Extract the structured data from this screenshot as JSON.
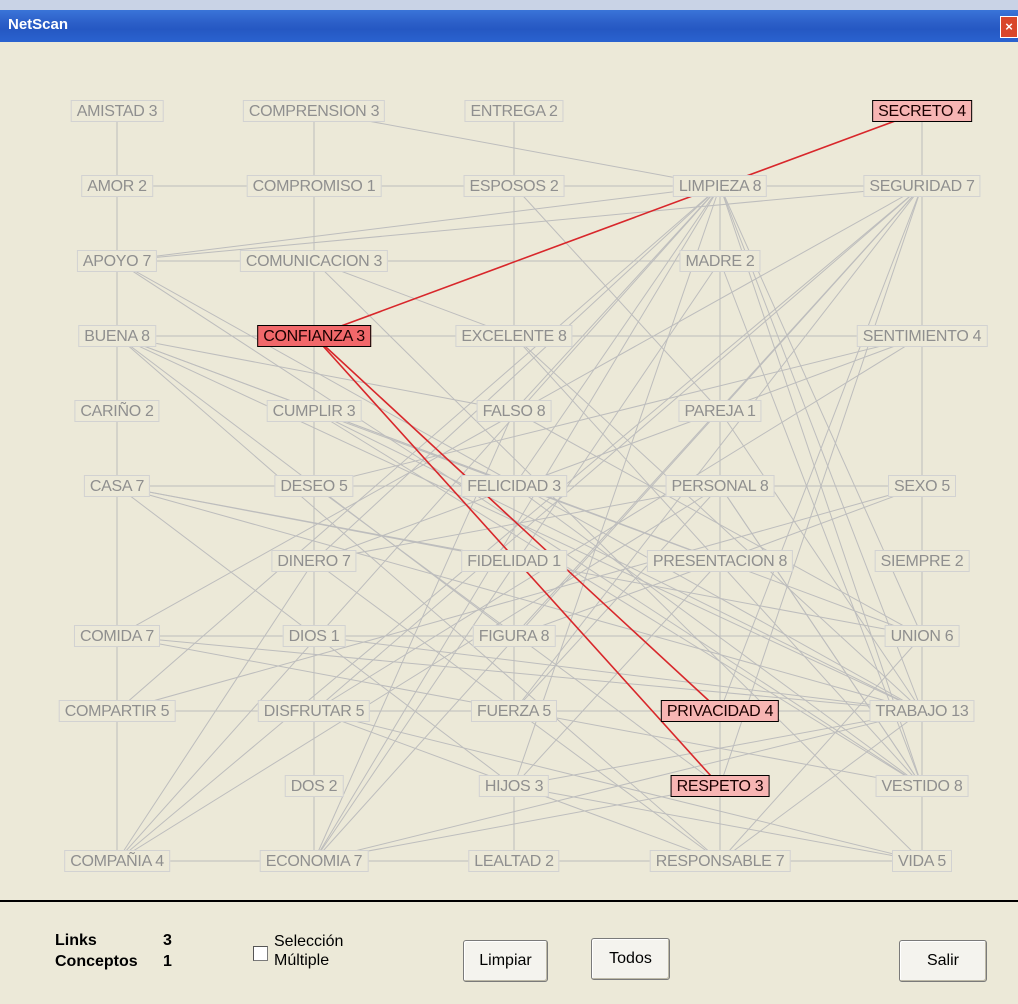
{
  "window": {
    "title": "NetScan",
    "close_label": "×"
  },
  "nodes": [
    {
      "id": "amistad",
      "label": "AMISTAD 3",
      "col": 0,
      "row": 0
    },
    {
      "id": "comprension",
      "label": "COMPRENSION 3",
      "col": 1,
      "row": 0
    },
    {
      "id": "entrega",
      "label": "ENTREGA 2",
      "col": 2,
      "row": 0
    },
    {
      "id": "secreto",
      "label": "SECRETO 4",
      "col": 4,
      "row": 0,
      "state": "linked"
    },
    {
      "id": "amor",
      "label": "AMOR 2",
      "col": 0,
      "row": 1
    },
    {
      "id": "compromiso",
      "label": "COMPROMISO 1",
      "col": 1,
      "row": 1
    },
    {
      "id": "esposos",
      "label": "ESPOSOS 2",
      "col": 2,
      "row": 1
    },
    {
      "id": "limpieza",
      "label": "LIMPIEZA 8",
      "col": 3,
      "row": 1
    },
    {
      "id": "seguridad",
      "label": "SEGURIDAD 7",
      "col": 4,
      "row": 1
    },
    {
      "id": "apoyo",
      "label": "APOYO 7",
      "col": 0,
      "row": 2
    },
    {
      "id": "comunicacion",
      "label": "COMUNICACION 3",
      "col": 1,
      "row": 2
    },
    {
      "id": "madre",
      "label": "MADRE 2",
      "col": 3,
      "row": 2
    },
    {
      "id": "buena",
      "label": "BUENA 8",
      "col": 0,
      "row": 3
    },
    {
      "id": "confianza",
      "label": "CONFIANZA 3",
      "col": 1,
      "row": 3,
      "state": "selected"
    },
    {
      "id": "excelente",
      "label": "EXCELENTE 8",
      "col": 2,
      "row": 3
    },
    {
      "id": "sentimiento",
      "label": "SENTIMIENTO 4",
      "col": 4,
      "row": 3
    },
    {
      "id": "carino",
      "label": "CARIÑO 2",
      "col": 0,
      "row": 4
    },
    {
      "id": "cumplir",
      "label": "CUMPLIR 3",
      "col": 1,
      "row": 4
    },
    {
      "id": "falso",
      "label": "FALSO 8",
      "col": 2,
      "row": 4
    },
    {
      "id": "pareja",
      "label": "PAREJA 1",
      "col": 3,
      "row": 4
    },
    {
      "id": "casa",
      "label": "CASA 7",
      "col": 0,
      "row": 5
    },
    {
      "id": "deseo",
      "label": "DESEO 5",
      "col": 1,
      "row": 5
    },
    {
      "id": "felicidad",
      "label": "FELICIDAD 3",
      "col": 2,
      "row": 5
    },
    {
      "id": "personal",
      "label": "PERSONAL 8",
      "col": 3,
      "row": 5
    },
    {
      "id": "sexo",
      "label": "SEXO 5",
      "col": 4,
      "row": 5
    },
    {
      "id": "dinero",
      "label": "DINERO 7",
      "col": 1,
      "row": 6
    },
    {
      "id": "fidelidad",
      "label": "FIDELIDAD 1",
      "col": 2,
      "row": 6
    },
    {
      "id": "presentacion",
      "label": "PRESENTACION 8",
      "col": 3,
      "row": 6
    },
    {
      "id": "siempre",
      "label": "SIEMPRE 2",
      "col": 4,
      "row": 6
    },
    {
      "id": "comida",
      "label": "COMIDA 7",
      "col": 0,
      "row": 7
    },
    {
      "id": "dios",
      "label": "DIOS 1",
      "col": 1,
      "row": 7
    },
    {
      "id": "figura",
      "label": "FIGURA 8",
      "col": 2,
      "row": 7
    },
    {
      "id": "union",
      "label": "UNION 6",
      "col": 4,
      "row": 7
    },
    {
      "id": "compartir",
      "label": "COMPARTIR 5",
      "col": 0,
      "row": 8
    },
    {
      "id": "disfrutar",
      "label": "DISFRUTAR 5",
      "col": 1,
      "row": 8
    },
    {
      "id": "fuerza",
      "label": "FUERZA 5",
      "col": 2,
      "row": 8
    },
    {
      "id": "privacidad",
      "label": "PRIVACIDAD 4",
      "col": 3,
      "row": 8,
      "state": "linked"
    },
    {
      "id": "trabajo",
      "label": "TRABAJO 13",
      "col": 4,
      "row": 8
    },
    {
      "id": "dos",
      "label": "DOS 2",
      "col": 1,
      "row": 9
    },
    {
      "id": "hijos",
      "label": "HIJOS 3",
      "col": 2,
      "row": 9
    },
    {
      "id": "respeto",
      "label": "RESPETO 3",
      "col": 3,
      "row": 9,
      "state": "linked"
    },
    {
      "id": "vestido",
      "label": "VESTIDO 8",
      "col": 4,
      "row": 9
    },
    {
      "id": "compania",
      "label": "COMPAÑIA 4",
      "col": 0,
      "row": 10
    },
    {
      "id": "economia",
      "label": "ECONOMIA 7",
      "col": 1,
      "row": 10
    },
    {
      "id": "lealtad",
      "label": "LEALTAD 2",
      "col": 2,
      "row": 10
    },
    {
      "id": "responsable",
      "label": "RESPONSABLE 7",
      "col": 3,
      "row": 10
    },
    {
      "id": "vida",
      "label": "VIDA 5",
      "col": 4,
      "row": 10
    }
  ],
  "highlighted_links": [
    [
      "confianza",
      "secreto"
    ],
    [
      "confianza",
      "privacidad"
    ],
    [
      "confianza",
      "respeto"
    ]
  ],
  "links": [
    [
      "amistad",
      "amor"
    ],
    [
      "amor",
      "apoyo"
    ],
    [
      "apoyo",
      "buena"
    ],
    [
      "buena",
      "carino"
    ],
    [
      "carino",
      "casa"
    ],
    [
      "casa",
      "comida"
    ],
    [
      "comida",
      "compartir"
    ],
    [
      "compartir",
      "compania"
    ],
    [
      "comprension",
      "compromiso"
    ],
    [
      "compromiso",
      "comunicacion"
    ],
    [
      "comunicacion",
      "confianza"
    ],
    [
      "confianza",
      "cumplir"
    ],
    [
      "cumplir",
      "deseo"
    ],
    [
      "deseo",
      "dinero"
    ],
    [
      "dinero",
      "dios"
    ],
    [
      "dios",
      "disfrutar"
    ],
    [
      "disfrutar",
      "dos"
    ],
    [
      "dos",
      "economia"
    ],
    [
      "entrega",
      "esposos"
    ],
    [
      "excelente",
      "falso"
    ],
    [
      "falso",
      "felicidad"
    ],
    [
      "felicidad",
      "fidelidad"
    ],
    [
      "fidelidad",
      "figura"
    ],
    [
      "figura",
      "fuerza"
    ],
    [
      "hijos",
      "lealtad"
    ],
    [
      "limpieza",
      "madre"
    ],
    [
      "madre",
      "pareja"
    ],
    [
      "pareja",
      "personal"
    ],
    [
      "personal",
      "presentacion"
    ],
    [
      "secreto",
      "seguridad"
    ],
    [
      "seguridad",
      "sentimiento"
    ],
    [
      "sentimiento",
      "sexo"
    ],
    [
      "sexo",
      "siempre"
    ],
    [
      "siempre",
      "union"
    ],
    [
      "union",
      "trabajo"
    ],
    [
      "trabajo",
      "vestido"
    ],
    [
      "vestido",
      "vida"
    ],
    [
      "amor",
      "compromiso"
    ],
    [
      "compromiso",
      "esposos"
    ],
    [
      "esposos",
      "limpieza"
    ],
    [
      "limpieza",
      "seguridad"
    ],
    [
      "apoyo",
      "comunicacion"
    ],
    [
      "comunicacion",
      "madre"
    ],
    [
      "buena",
      "confianza"
    ],
    [
      "confianza",
      "excelente"
    ],
    [
      "excelente",
      "sentimiento"
    ],
    [
      "casa",
      "deseo"
    ],
    [
      "deseo",
      "felicidad"
    ],
    [
      "felicidad",
      "personal"
    ],
    [
      "personal",
      "sexo"
    ],
    [
      "compartir",
      "disfrutar"
    ],
    [
      "disfrutar",
      "fuerza"
    ],
    [
      "fuerza",
      "privacidad"
    ],
    [
      "privacidad",
      "trabajo"
    ],
    [
      "compania",
      "economia"
    ],
    [
      "economia",
      "lealtad"
    ],
    [
      "lealtad",
      "responsable"
    ],
    [
      "responsable",
      "vida"
    ],
    [
      "amistad",
      "buena"
    ],
    [
      "amistad",
      "casa"
    ],
    [
      "comprension",
      "limpieza"
    ],
    [
      "comprension",
      "cumplir"
    ],
    [
      "entrega",
      "felicidad"
    ],
    [
      "entrega",
      "excelente"
    ],
    [
      "apoyo",
      "seguridad"
    ],
    [
      "apoyo",
      "limpieza"
    ],
    [
      "apoyo",
      "trabajo"
    ],
    [
      "apoyo",
      "vestido"
    ],
    [
      "buena",
      "falso"
    ],
    [
      "buena",
      "trabajo"
    ],
    [
      "buena",
      "union"
    ],
    [
      "buena",
      "responsable"
    ],
    [
      "buena",
      "figura"
    ],
    [
      "buena",
      "presentacion"
    ],
    [
      "casa",
      "trabajo"
    ],
    [
      "casa",
      "hijos"
    ],
    [
      "casa",
      "union"
    ],
    [
      "casa",
      "fidelidad"
    ],
    [
      "comida",
      "trabajo"
    ],
    [
      "comida",
      "seguridad"
    ],
    [
      "comida",
      "figura"
    ],
    [
      "comida",
      "vestido"
    ],
    [
      "compartir",
      "limpieza"
    ],
    [
      "compartir",
      "sexo"
    ],
    [
      "compania",
      "seguridad"
    ],
    [
      "compania",
      "dinero"
    ],
    [
      "compania",
      "personal"
    ],
    [
      "compania",
      "limpieza"
    ],
    [
      "comunicacion",
      "vida"
    ],
    [
      "comunicacion",
      "excelente"
    ],
    [
      "cumplir",
      "trabajo"
    ],
    [
      "cumplir",
      "economia"
    ],
    [
      "cumplir",
      "presentacion"
    ],
    [
      "cumplir",
      "vestido"
    ],
    [
      "deseo",
      "sentimiento"
    ],
    [
      "deseo",
      "respeto"
    ],
    [
      "dinero",
      "limpieza"
    ],
    [
      "dinero",
      "sentimiento"
    ],
    [
      "dinero",
      "economia"
    ],
    [
      "dinero",
      "responsable"
    ],
    [
      "dios",
      "trabajo"
    ],
    [
      "dios",
      "union"
    ],
    [
      "disfrutar",
      "vida"
    ],
    [
      "disfrutar",
      "seguridad"
    ],
    [
      "disfrutar",
      "responsable"
    ],
    [
      "economia",
      "trabajo"
    ],
    [
      "economia",
      "seguridad"
    ],
    [
      "economia",
      "limpieza"
    ],
    [
      "economia",
      "madre"
    ],
    [
      "excelente",
      "trabajo"
    ],
    [
      "excelente",
      "vestido"
    ],
    [
      "falso",
      "limpieza"
    ],
    [
      "falso",
      "union"
    ],
    [
      "falso",
      "economia"
    ],
    [
      "felicidad",
      "vestido"
    ],
    [
      "felicidad",
      "limpieza"
    ],
    [
      "figura",
      "seguridad"
    ],
    [
      "figura",
      "presentacion"
    ],
    [
      "fuerza",
      "seguridad"
    ],
    [
      "fuerza",
      "personal"
    ],
    [
      "hijos",
      "trabajo"
    ],
    [
      "hijos",
      "limpieza"
    ],
    [
      "hijos",
      "vida"
    ],
    [
      "limpieza",
      "trabajo"
    ],
    [
      "limpieza",
      "respeto"
    ],
    [
      "limpieza",
      "responsable"
    ],
    [
      "limpieza",
      "vestido"
    ],
    [
      "madre",
      "vestido"
    ],
    [
      "pareja",
      "trabajo"
    ],
    [
      "pareja",
      "esposos"
    ],
    [
      "personal",
      "dinero"
    ],
    [
      "personal",
      "vestido"
    ],
    [
      "presentacion",
      "sexo"
    ],
    [
      "presentacion",
      "hijos"
    ],
    [
      "privacidad",
      "seguridad"
    ],
    [
      "respeto",
      "seguridad"
    ],
    [
      "respeto",
      "economia"
    ],
    [
      "responsable",
      "trabajo"
    ],
    [
      "responsable",
      "union"
    ],
    [
      "vestido",
      "personal"
    ],
    [
      "trabajo",
      "seguridad"
    ],
    [
      "union",
      "limpieza"
    ],
    [
      "sentimiento",
      "disfrutar"
    ],
    [
      "comprension",
      "dios"
    ]
  ],
  "footer": {
    "links_label": "Links",
    "links_value": "3",
    "conceptos_label": "Conceptos",
    "conceptos_value": "1",
    "checkbox_line1": "Selección",
    "checkbox_line2": "Múltiple",
    "limpiar": "Limpiar",
    "todos": "Todos",
    "salir": "Salir"
  },
  "colors": {
    "highlight_link": "#d8272b",
    "link": "#bdbdbd",
    "selected_bg": "#f1686a",
    "linked_bg": "#f7b5b3"
  }
}
